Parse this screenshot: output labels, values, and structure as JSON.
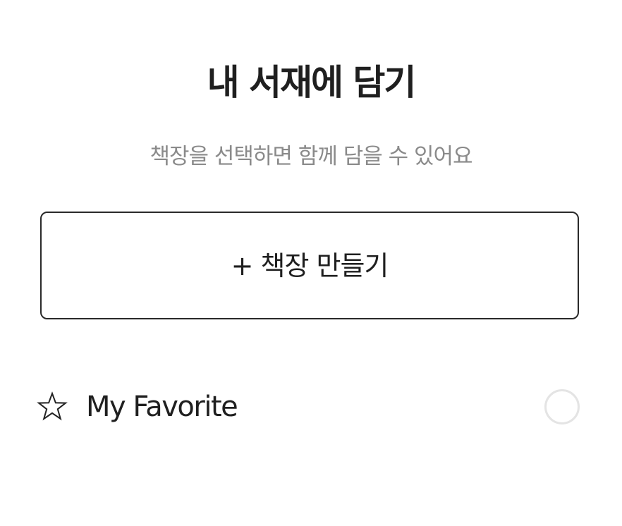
{
  "dialog": {
    "title": "내 서재에 담기",
    "subtitle": "책장을 선택하면 함께 담을 수 있어요",
    "create_shelf_label": "+ 책장 만들기"
  },
  "shelves": [
    {
      "icon": "star-outline-icon",
      "label": "My Favorite",
      "selected": false
    }
  ]
}
